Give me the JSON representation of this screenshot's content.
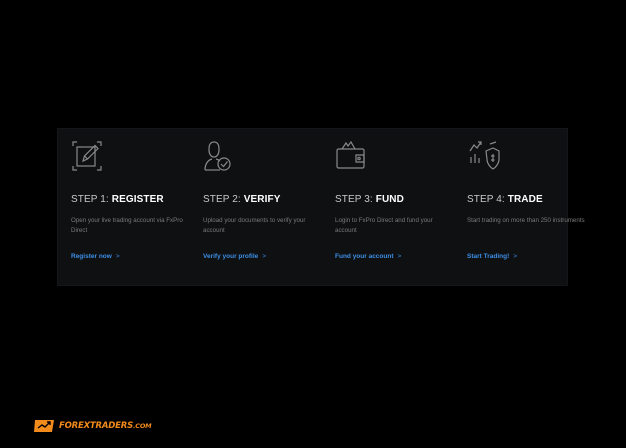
{
  "steps": [
    {
      "number": "STEP 1:",
      "name": "REGISTER",
      "description": "Open your live trading account via FxPro Direct",
      "link": "Register now",
      "icon": "register-edit-icon"
    },
    {
      "number": "STEP 2:",
      "name": "VERIFY",
      "description": "Upload your documents to verify your account",
      "link": "Verify your profile",
      "icon": "user-check-icon"
    },
    {
      "number": "STEP 3:",
      "name": "FUND",
      "description": "Login to FxPro Direct and fund your account",
      "link": "Fund your account",
      "icon": "wallet-icon"
    },
    {
      "number": "STEP 4:",
      "name": "TRADE",
      "description": "Start trading on more than 250 instruments",
      "link": "Start Trading!",
      "icon": "trade-shield-icon"
    }
  ],
  "link_chevron": ">",
  "colors": {
    "accent": "#3d8fe6",
    "icon_stroke": "#8a8a8a",
    "brand": "#f28a1c"
  },
  "watermark": {
    "name": "FOREXTRADERS",
    "domain": ".COM"
  }
}
